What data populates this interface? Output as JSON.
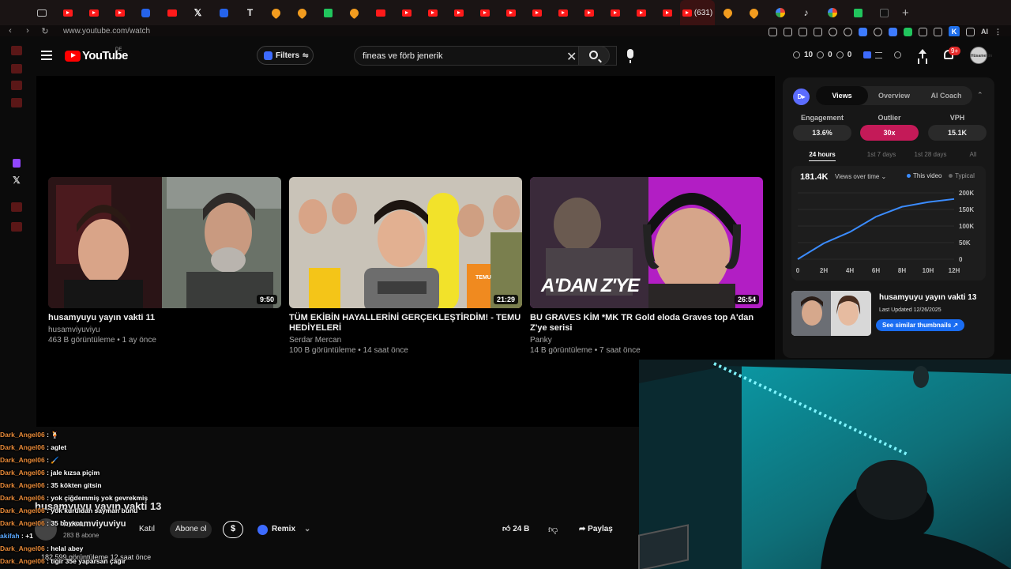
{
  "browser": {
    "url": "www.youtube.com/watch",
    "active_tab_count": "(631)"
  },
  "header": {
    "logo_text": "YouTube",
    "logo_country": "DE",
    "filters_label": "Filters",
    "search_value": "fineas ve förb jenerik",
    "stat_one": "10",
    "stat_two": "0",
    "stat_three": "0",
    "notification_badge": "9+",
    "avatar_text": "Hüsamettin"
  },
  "cards": [
    {
      "title": "husamyuyu yayın vakti 11",
      "channel": "husamviyuviyu",
      "meta": "463 B görüntüleme • 1 ay önce",
      "duration": "9:50"
    },
    {
      "title": "TÜM EKİBİN HAYALLERİNİ GERÇEKLEŞTİRDİM! - TEMU HEDİYELERİ",
      "channel": "Serdar Mercan",
      "meta": "100 B görüntüleme • 14 saat önce",
      "duration": "21:29",
      "temu_label": "TEMU"
    },
    {
      "title": "BU GRAVES KİM *MK TR Gold eloda Graves top A'dan Z'ye serisi",
      "channel": "Panky",
      "meta": "14 B görüntüleme • 7 saat önce",
      "duration": "26:54",
      "overlay_text": "A'DAN Z'YE"
    }
  ],
  "sidepanel": {
    "logo": "D▸",
    "tabs": [
      "Views",
      "Overview",
      "AI Coach"
    ],
    "metrics": [
      {
        "label": "Engagement",
        "value": "13.6%"
      },
      {
        "label": "Outlier",
        "value": "30x"
      },
      {
        "label": "VPH",
        "value": "15.1K"
      }
    ],
    "ranges": [
      "24 hours",
      "1st 7 days",
      "1st 28 days",
      "All"
    ],
    "total": "181.4K",
    "chart_mode": "Views over time ⌄",
    "legend_this": "This video",
    "legend_typical": "Typical",
    "similar": {
      "title": "husamyuyu yayın vakti 13",
      "updated": "Last Updated 12/26/2025",
      "button": "See similar thumbnails ↗"
    }
  },
  "chart_data": {
    "type": "line",
    "title": "",
    "x": [
      "0",
      "2H",
      "4H",
      "6H",
      "8H",
      "10H",
      "12H"
    ],
    "y_ticks": [
      "0",
      "50K",
      "100K",
      "150K",
      "200K"
    ],
    "ylim": [
      0,
      200000
    ],
    "series": [
      {
        "name": "This video",
        "color": "#3b8cff",
        "values": [
          0,
          48000,
          82000,
          128000,
          158000,
          172000,
          181400
        ]
      }
    ]
  },
  "video": {
    "title": "husamyuyu yayın vakti 13",
    "channel": "husamviyuviyu",
    "subscribers": "283 B abone",
    "join_label": "Katıl",
    "subscribe_label": "Abone ol",
    "dollar_label": "$",
    "remix_label": "Remix",
    "remix_caret": "⌄",
    "like_count": "24 B",
    "share_label": "Paylaş",
    "views_line": "182.599 görüntüleme  12 saat önce"
  },
  "chat": [
    {
      "user": "Dark_Angel06",
      "msg": ": 🍹"
    },
    {
      "user": "Dark_Angel06",
      "msg": ": aglet"
    },
    {
      "user": "Dark_Angel06",
      "msg": ": 🖌️"
    },
    {
      "user": "Dark_Angel06",
      "msg": ": jale kızsa piçim"
    },
    {
      "user": "Dark_Angel06",
      "msg": ": 35 kökten gitsin"
    },
    {
      "user": "Dark_Angel06",
      "msg": ": yok çiğdemmiş yok gevrekmiş"
    },
    {
      "user": "Dark_Angel06",
      "msg": ": yok kuruldan sayman bunu"
    },
    {
      "user": "Dark_Angel06",
      "msg": ": 35 boykot"
    },
    {
      "user": "akifah",
      "msg": ": +1",
      "style": "blue"
    },
    {
      "user": "Dark_Angel06",
      "msg": ": helal abey"
    },
    {
      "user": "Dark_Angel06",
      "msg": ": tigir 35e yaparsan çağır"
    }
  ],
  "colors": {
    "accent_red": "#ff0000",
    "outlier": "#c41a58",
    "link_blue": "#1a6df2",
    "chat_user": "#e88a38"
  }
}
